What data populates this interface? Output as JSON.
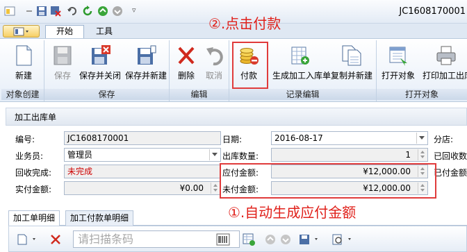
{
  "window": {
    "doc_no": "JC1608170001"
  },
  "ribbon_tabs": [
    "开始",
    "工具"
  ],
  "groups": {
    "create": "对象创建",
    "save": "保存",
    "edit": "编辑",
    "record": "记录编辑",
    "open": "打开对象"
  },
  "buttons": {
    "new": "新建",
    "save": "保存",
    "save_close": "保存并关闭",
    "save_new": "保存并新建",
    "delete": "删除",
    "cancel": "取消",
    "pay": "付款",
    "gen_store": "生成加工入库单",
    "copy_new": "复制并新建",
    "open_obj": "打开对象",
    "print": "打印加工出库"
  },
  "annotations": {
    "step2": "②.点击付款",
    "step1": "①.自动生成应付金额"
  },
  "form": {
    "section": "加工出库单",
    "no_label": "编号:",
    "no_value": "JC1608170001",
    "staff_label": "业务员:",
    "staff_value": "管理员",
    "recv_label": "回收完成:",
    "recv_value": "未完成",
    "paid_label": "实付金额:",
    "paid_value": "¥0.00",
    "date_label": "日期:",
    "date_value": "2016-08-17",
    "qty_label": "出库数量:",
    "qty_value": "1",
    "payable_label": "应付金额:",
    "payable_value": "¥12,000.00",
    "unpaid_label": "未付金额:",
    "unpaid_value": "¥12,000.00",
    "branch_label": "分店:",
    "recv_qty_label": "已回收数",
    "recv_amt_label": "已付金额"
  },
  "subtabs": [
    "加工单明细",
    "加工付款单明细"
  ],
  "scan_placeholder": "请扫描条码",
  "colors": {
    "highlight": "#e03b3b",
    "annotation": "#e0201a",
    "unfinished": "#cc0000"
  }
}
